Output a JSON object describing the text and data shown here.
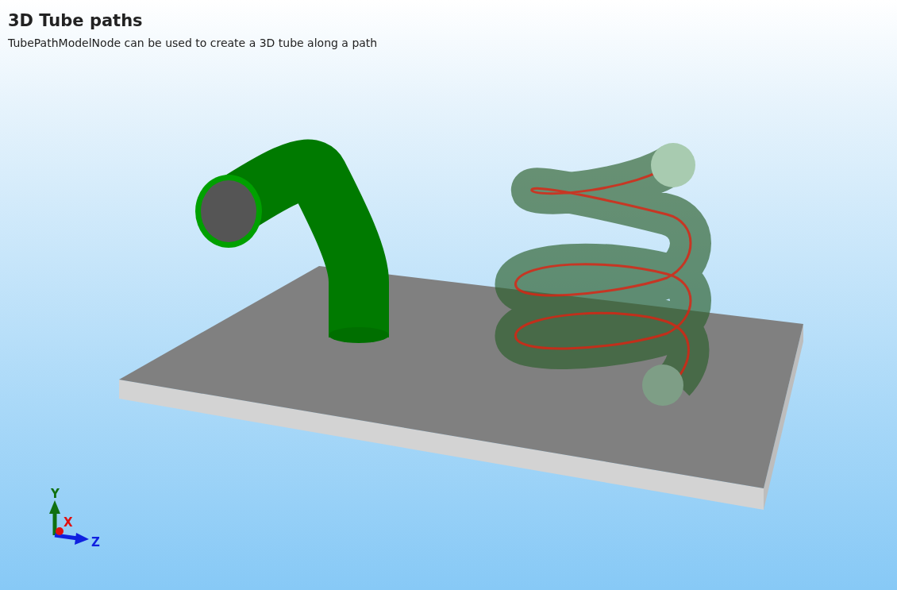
{
  "title": "3D Tube paths",
  "description": "TubePathModelNode can be used to create a 3D tube along a path",
  "axes": {
    "x_label": "X",
    "y_label": "Y",
    "z_label": "Z"
  }
}
